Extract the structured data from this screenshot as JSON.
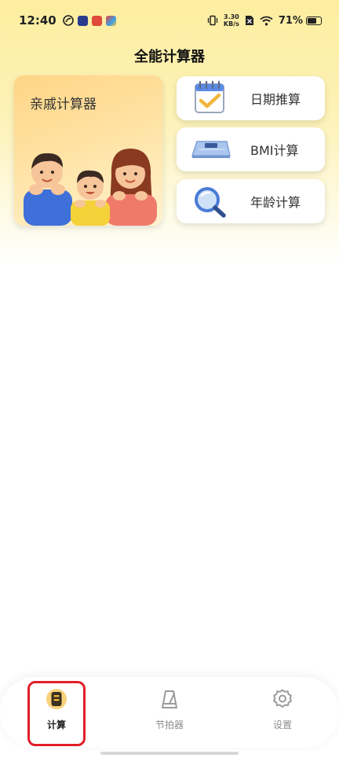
{
  "status_bar": {
    "time": "12:40",
    "net_speed_value": "3.30",
    "net_speed_unit": "KB/s",
    "battery_percent": "71%",
    "battery_level": 0.71
  },
  "page": {
    "title": "全能计算器"
  },
  "cards": {
    "relative": {
      "label": "亲戚计算器"
    },
    "date": {
      "label": "日期推算"
    },
    "bmi": {
      "label": "BMI计算"
    },
    "age": {
      "label": "年龄计算"
    }
  },
  "bottom_nav": {
    "items": [
      {
        "label": "计算",
        "active": true
      },
      {
        "label": "节拍器",
        "active": false
      },
      {
        "label": "设置",
        "active": false
      }
    ]
  },
  "colors": {
    "accent": "#f2b53c",
    "highlight": "#e01f2a",
    "inactive": "#8c8c8c"
  }
}
